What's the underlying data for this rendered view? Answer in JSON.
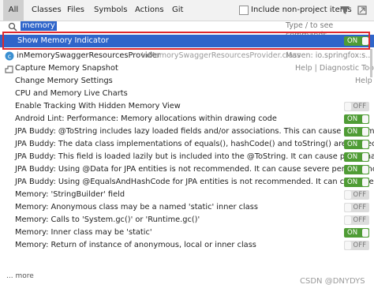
{
  "tabs": [
    {
      "label": "All",
      "active": true
    },
    {
      "label": "Classes"
    },
    {
      "label": "Files"
    },
    {
      "label": "Symbols"
    },
    {
      "label": "Actions"
    },
    {
      "label": "Git"
    }
  ],
  "include_label": "Include non-project items",
  "search": {
    "query": "memory",
    "hint": "Type / to see commands"
  },
  "selected": {
    "label": "Show Memory Indicator",
    "toggle": "ON"
  },
  "class_row": {
    "name": "inMemorySwaggerResourcesProvider",
    "file": "InMemorySwaggerResourcesProvider.class",
    "source": "Maven: io.springfox:s..."
  },
  "capture_row": {
    "label": "Capture Memory Snapshot",
    "note": "Help | Diagnostic Tools"
  },
  "items": [
    {
      "label": "Change Memory Settings",
      "note": "Help"
    },
    {
      "label": "CPU and Memory Live Charts",
      "note": ""
    },
    {
      "label": "Enable Tracking With Hidden Memory View",
      "toggle": "OFF"
    },
    {
      "label": "Android Lint: Performance: Memory allocations within drawing code",
      "toggle": "ON"
    },
    {
      "label": "JPA Buddy: @ToString includes lazy loaded fields and/or associations. This can cause performance...",
      "toggle": "ON"
    },
    {
      "label": "JPA Buddy: The data class implementations of equals(), hashCode() and toString() are not recomme...",
      "toggle": "ON"
    },
    {
      "label": "JPA Buddy: This field is loaded lazily but is included into the @ToString. It can cause performance...",
      "toggle": "ON"
    },
    {
      "label": "JPA Buddy: Using @Data for JPA entities is not recommended. It can cause severe performance and...",
      "toggle": "ON"
    },
    {
      "label": "JPA Buddy: Using @EqualsAndHashCode for JPA entities is not recommended. It can cause severe...",
      "toggle": "ON"
    },
    {
      "label": "Memory: 'StringBuilder' field",
      "toggle": "OFF"
    },
    {
      "label": "Memory: Anonymous class may be a named 'static' inner class",
      "toggle": "OFF"
    },
    {
      "label": "Memory: Calls to 'System.gc()' or 'Runtime.gc()'",
      "toggle": "OFF"
    },
    {
      "label": "Memory: Inner class may be 'static'",
      "toggle": "ON"
    },
    {
      "label": "Memory: Return of instance of anonymous, local or inner class",
      "toggle": "OFF"
    }
  ],
  "more_label": "... more",
  "watermark": "CSDN @DNYDYS",
  "colors": {
    "selection": "#2f65ca",
    "toggle_on": "#4f9c35",
    "toggle_off": "#dcdcdc",
    "highlight_border": "#e0282d"
  }
}
